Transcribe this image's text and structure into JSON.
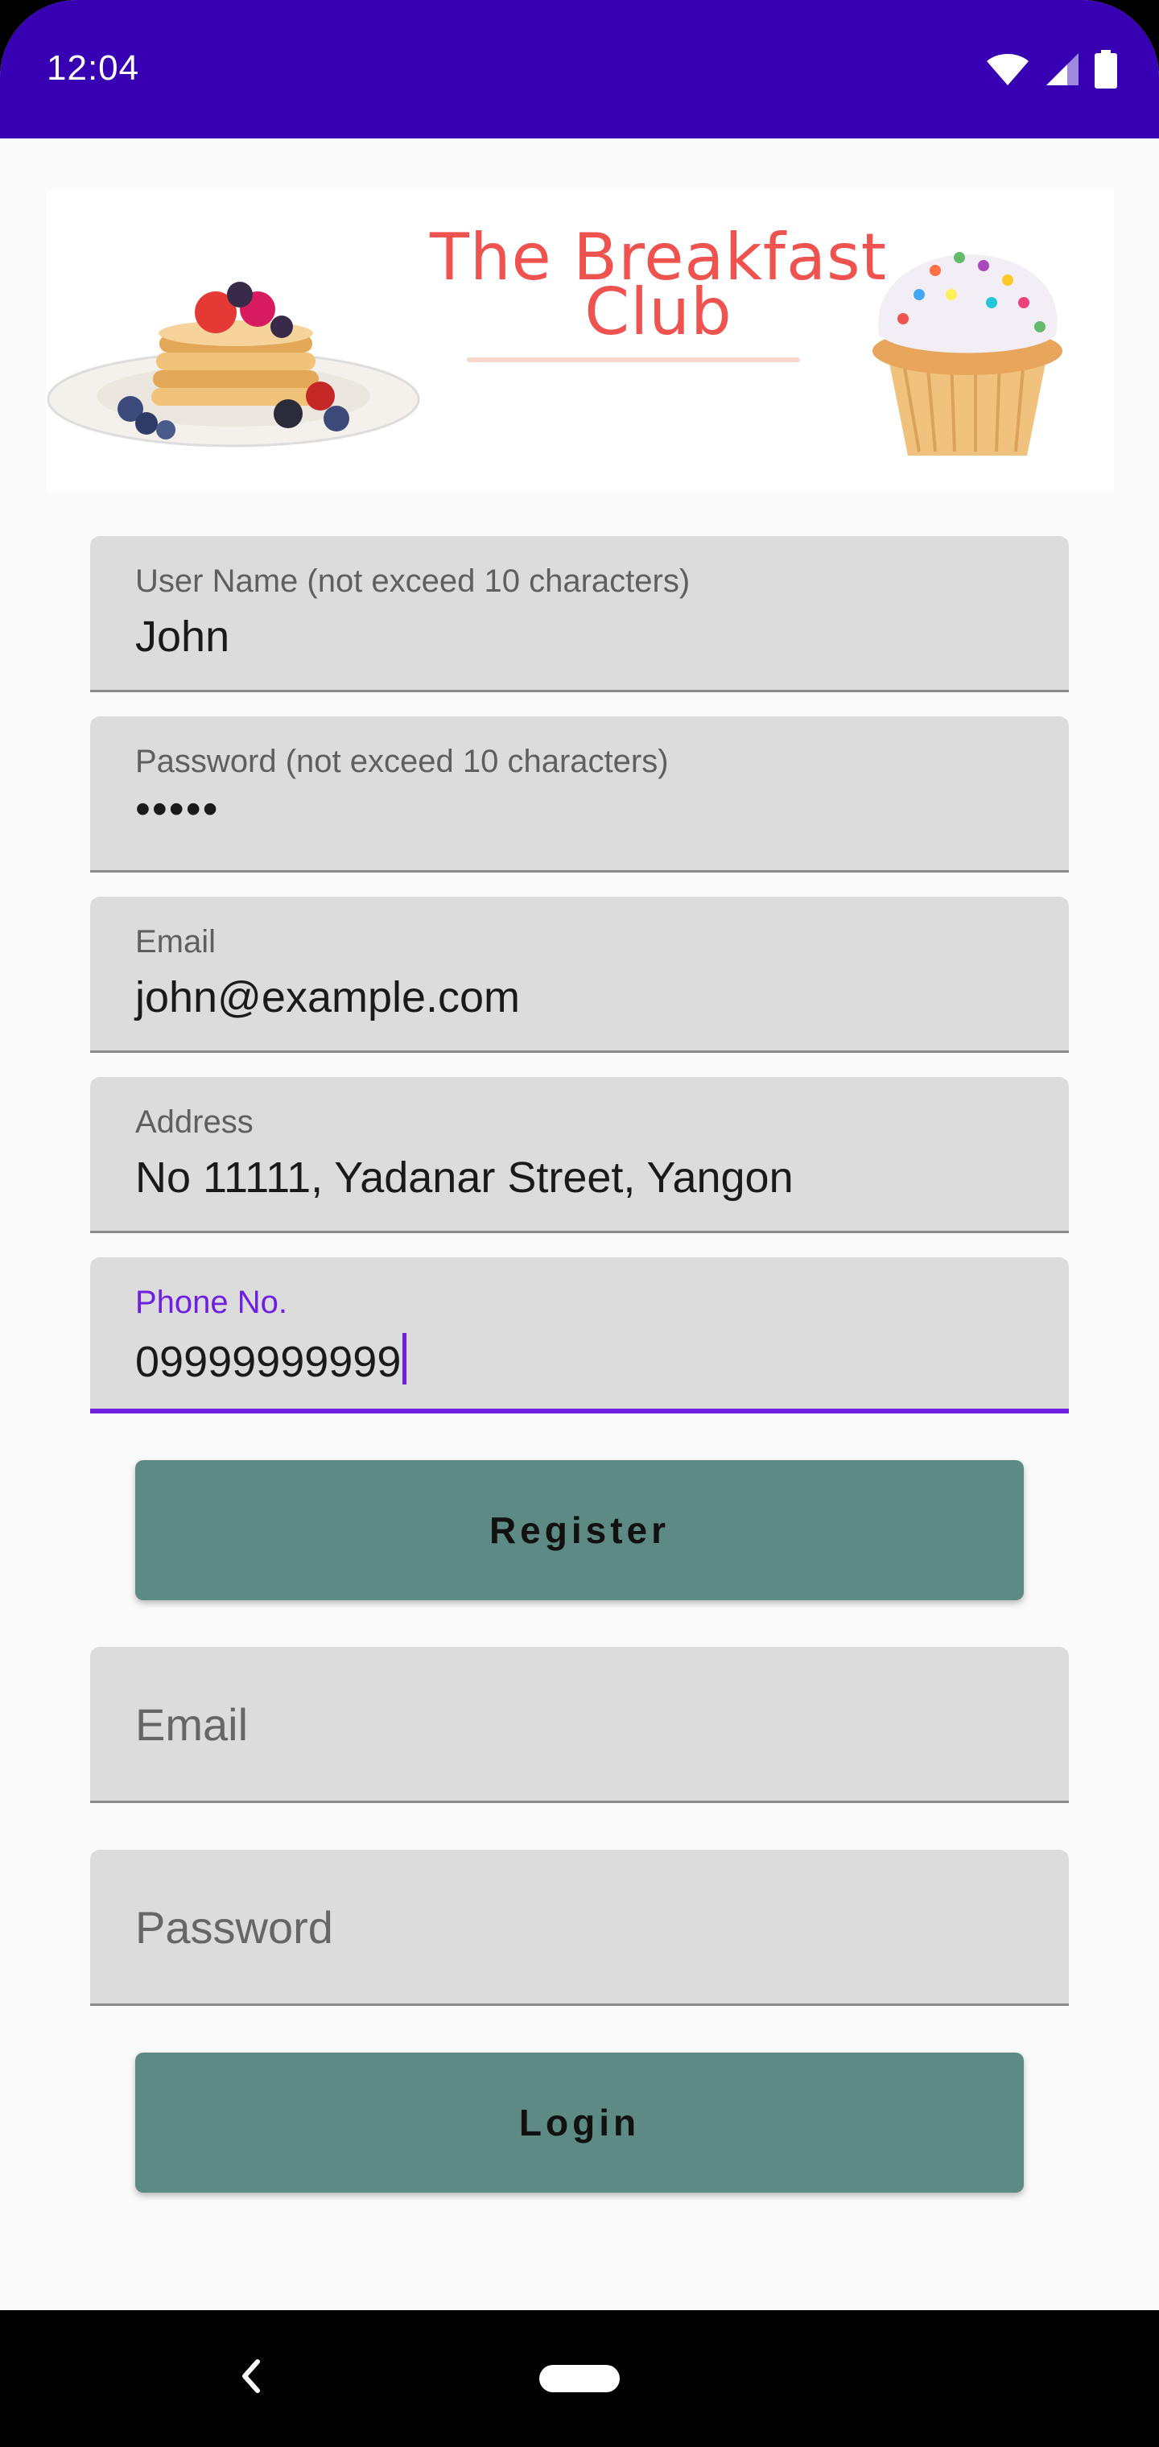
{
  "status_bar": {
    "time": "12:04",
    "icons": [
      "wifi-icon",
      "cell-signal-icon",
      "battery-icon"
    ],
    "color": "#3700b3"
  },
  "banner": {
    "title_line1": "The Breakfast",
    "title_line2": "Club",
    "title_color": "#ef5350",
    "images": [
      "pancake-stack-image",
      "cupcake-image"
    ]
  },
  "register_form": {
    "username": {
      "label": "User Name (not exceed 10 characters)",
      "value": "John"
    },
    "password": {
      "label": "Password (not exceed 10 characters)",
      "value": "•••••"
    },
    "email": {
      "label": "Email",
      "value": "john@example.com"
    },
    "address": {
      "label": "Address",
      "value": "No 11111, Yadanar Street, Yangon"
    },
    "phone": {
      "label": "Phone No.",
      "value": "09999999999"
    },
    "register_label": "Register"
  },
  "login_form": {
    "email_placeholder": "Email",
    "password_placeholder": "Password",
    "login_label": "Login"
  },
  "colors": {
    "accent": "#6f1fe0",
    "button": "#5e8a84",
    "field_bg": "#dcdcdc"
  },
  "nav_bar": {
    "icons": [
      "back-icon",
      "home-pill-icon"
    ]
  }
}
